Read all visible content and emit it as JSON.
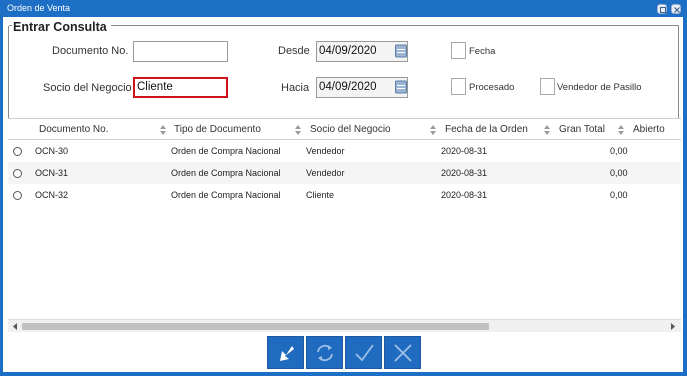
{
  "window": {
    "title": "Orden de Venta"
  },
  "form": {
    "legend": "Entrar Consulta",
    "documento_label": "Documento No.",
    "documento_value": "",
    "desde_label": "Desde",
    "desde_value": "04/09/2020",
    "socio_label": "Socio del Negocio",
    "socio_value": "Cliente",
    "hacia_label": "Hacia",
    "hacia_value": "04/09/2020",
    "fecha_label": "Fecha",
    "procesado_label": "Procesado",
    "vendedor_label": "Vendedor de Pasillo"
  },
  "table": {
    "headers": [
      "Documento No.",
      "Tipo de Documento",
      "Socio del Negocio",
      "Fecha de la Orden",
      "Gran Total",
      "Abierto"
    ],
    "rows": [
      {
        "doc": "OCN-30",
        "tipo": "Orden de Compra Nacional",
        "socio": "Vendedor",
        "fecha": "2020-08-31",
        "total": "0,00"
      },
      {
        "doc": "OCN-31",
        "tipo": "Orden de Compra Nacional",
        "socio": "Vendedor",
        "fecha": "2020-08-31",
        "total": "0,00"
      },
      {
        "doc": "OCN-32",
        "tipo": "Orden de Compra Nacional",
        "socio": "Cliente",
        "fecha": "2020-08-31",
        "total": "0,00"
      }
    ]
  },
  "actions": {
    "buttons": [
      "back-icon",
      "refresh-icon",
      "ok-icon",
      "cancel-icon"
    ]
  },
  "colors": {
    "accent": "#1c6fc4",
    "button": "#1f6bbf",
    "active_border": "#d0121b"
  }
}
